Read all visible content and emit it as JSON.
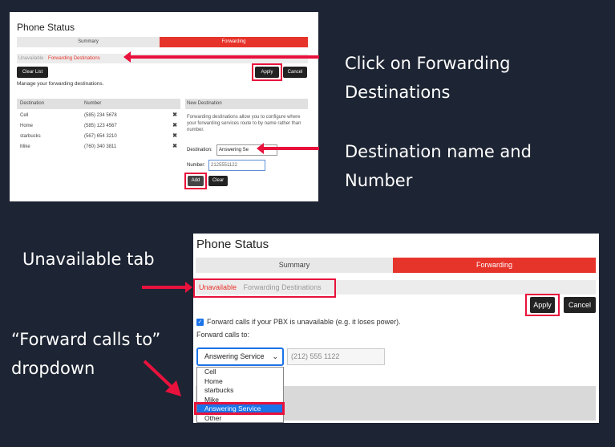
{
  "panel1": {
    "title": "Phone Status",
    "tabs": {
      "summary": "Summary",
      "forwarding": "Forwarding"
    },
    "subtabs": {
      "unavailable": "Unavailable",
      "forwarding_destinations": "Forwarding Destinations"
    },
    "buttons": {
      "clear_list": "Clear List",
      "apply": "Apply",
      "cancel": "Cancel",
      "add": "Add",
      "clear": "Clear"
    },
    "manage_text": "Manage your forwarding destinations.",
    "table": {
      "headers": {
        "destination": "Destination",
        "number": "Number"
      },
      "rows": [
        {
          "destination": "Cell",
          "number": "(585) 234 5678"
        },
        {
          "destination": "Home",
          "number": "(585) 123 4567"
        },
        {
          "destination": "starbucks",
          "number": "(567) 654 3210"
        },
        {
          "destination": "Mike",
          "number": "(760) 340 3811"
        }
      ],
      "delete_glyph": "✖"
    },
    "new_destination": {
      "header": "New Destination",
      "description": "Forwarding destinations allow you to configure where your forwarding services route to by name rather than number.",
      "destination_label": "Destination:",
      "destination_value": "Answering Se",
      "number_label": "Number:",
      "number_value": "2125551122"
    }
  },
  "captions": {
    "click_forwarding": "Click on Forwarding Destinations",
    "dest_name_number": "Destination name and Number",
    "unavailable_tab": "Unavailable tab",
    "forward_dropdown": "“Forward calls to” dropdown"
  },
  "panel2": {
    "title": "Phone Status",
    "tabs": {
      "summary": "Summary",
      "forwarding": "Forwarding"
    },
    "subtabs": {
      "unavailable": "Unavailable",
      "forwarding_destinations": "Forwarding Destinations"
    },
    "buttons": {
      "apply": "Apply",
      "cancel": "Cancel"
    },
    "checkbox_label": "Forward calls if your PBX is unavailable (e.g. it loses power).",
    "forward_label": "Forward calls to:",
    "select_value": "Answering Service",
    "phone_value": "(212) 555 1122",
    "options": [
      "Cell",
      "Home",
      "starbucks",
      "Mike",
      "Answering Service",
      "Other"
    ],
    "selected_option": "Answering Service"
  },
  "colors": {
    "accent": "#e6342b",
    "highlight": "#e8123c",
    "background": "#1d2433"
  }
}
